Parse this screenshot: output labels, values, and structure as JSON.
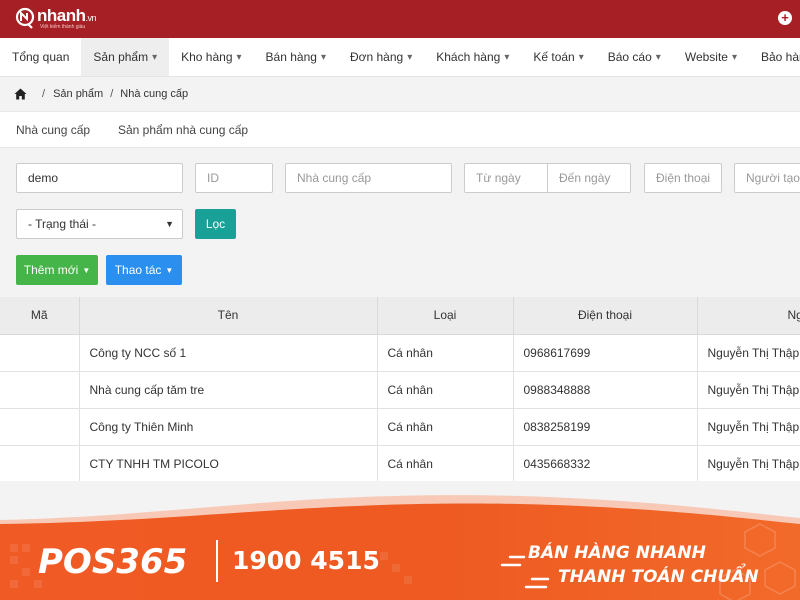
{
  "brand": {
    "name": "nhanh",
    "suffix": ".vn",
    "tagline": "Việt kiếm thành giàu"
  },
  "nav": {
    "items": [
      {
        "label": "Tổng quan",
        "caret": false
      },
      {
        "label": "Sản phẩm",
        "caret": true
      },
      {
        "label": "Kho hàng",
        "caret": true
      },
      {
        "label": "Bán hàng",
        "caret": true
      },
      {
        "label": "Đơn hàng",
        "caret": true
      },
      {
        "label": "Khách hàng",
        "caret": true
      },
      {
        "label": "Kế toán",
        "caret": true
      },
      {
        "label": "Báo cáo",
        "caret": true
      },
      {
        "label": "Website",
        "caret": true
      },
      {
        "label": "Bảo hành",
        "caret": false
      }
    ]
  },
  "breadcrumb": {
    "level1": "Sản phẩm",
    "level2": "Nhà cung cấp"
  },
  "subtabs": [
    "Nhà cung cấp",
    "Sản phẩm nhà cung cấp"
  ],
  "filters": {
    "keyword_value": "demo",
    "id_placeholder": "ID",
    "supplier_placeholder": "Nhà cung cấp",
    "from_date_placeholder": "Từ ngày",
    "to_date_placeholder": "Đến ngày",
    "phone_placeholder": "Điện thoại",
    "creator_placeholder": "Người tạo",
    "status_selected": "- Trạng thái -",
    "filter_button": "Lọc",
    "add_new_button": "Thêm mới",
    "actions_button": "Thao tác"
  },
  "table": {
    "headers": [
      "Mã",
      "Tên",
      "Loại",
      "Điện thoại",
      "Ng"
    ],
    "rows": [
      {
        "ma": "",
        "ten": "Công ty NCC số 1",
        "loai": "Cá nhân",
        "dien_thoai": "0968617699",
        "nguoi": "Nguyễn Thị Thập"
      },
      {
        "ma": "",
        "ten": "Nhà cung cấp tăm tre",
        "loai": "Cá nhân",
        "dien_thoai": "0988348888",
        "nguoi": "Nguyễn Thị Thập"
      },
      {
        "ma": "",
        "ten": "Công ty Thiên Minh",
        "loai": "Cá nhân",
        "dien_thoai": "0838258199",
        "nguoi": "Nguyễn Thị Thập"
      },
      {
        "ma": "",
        "ten": "CTY TNHH TM PICOLO",
        "loai": "Cá nhân",
        "dien_thoai": "0435668332",
        "nguoi": "Nguyễn Thị Thập"
      }
    ]
  },
  "banner": {
    "logo": "POS365",
    "hotline": "1900 4515",
    "slogan_line1": "BÁN HÀNG NHANH",
    "slogan_line2": "THANH TOÁN CHUẨN"
  },
  "colors": {
    "topbar": "#a51f24",
    "filter_button": "#1aa197",
    "add_button": "#45b549",
    "actions_button": "#2b8ff0",
    "banner_orange": "#f05a24"
  }
}
